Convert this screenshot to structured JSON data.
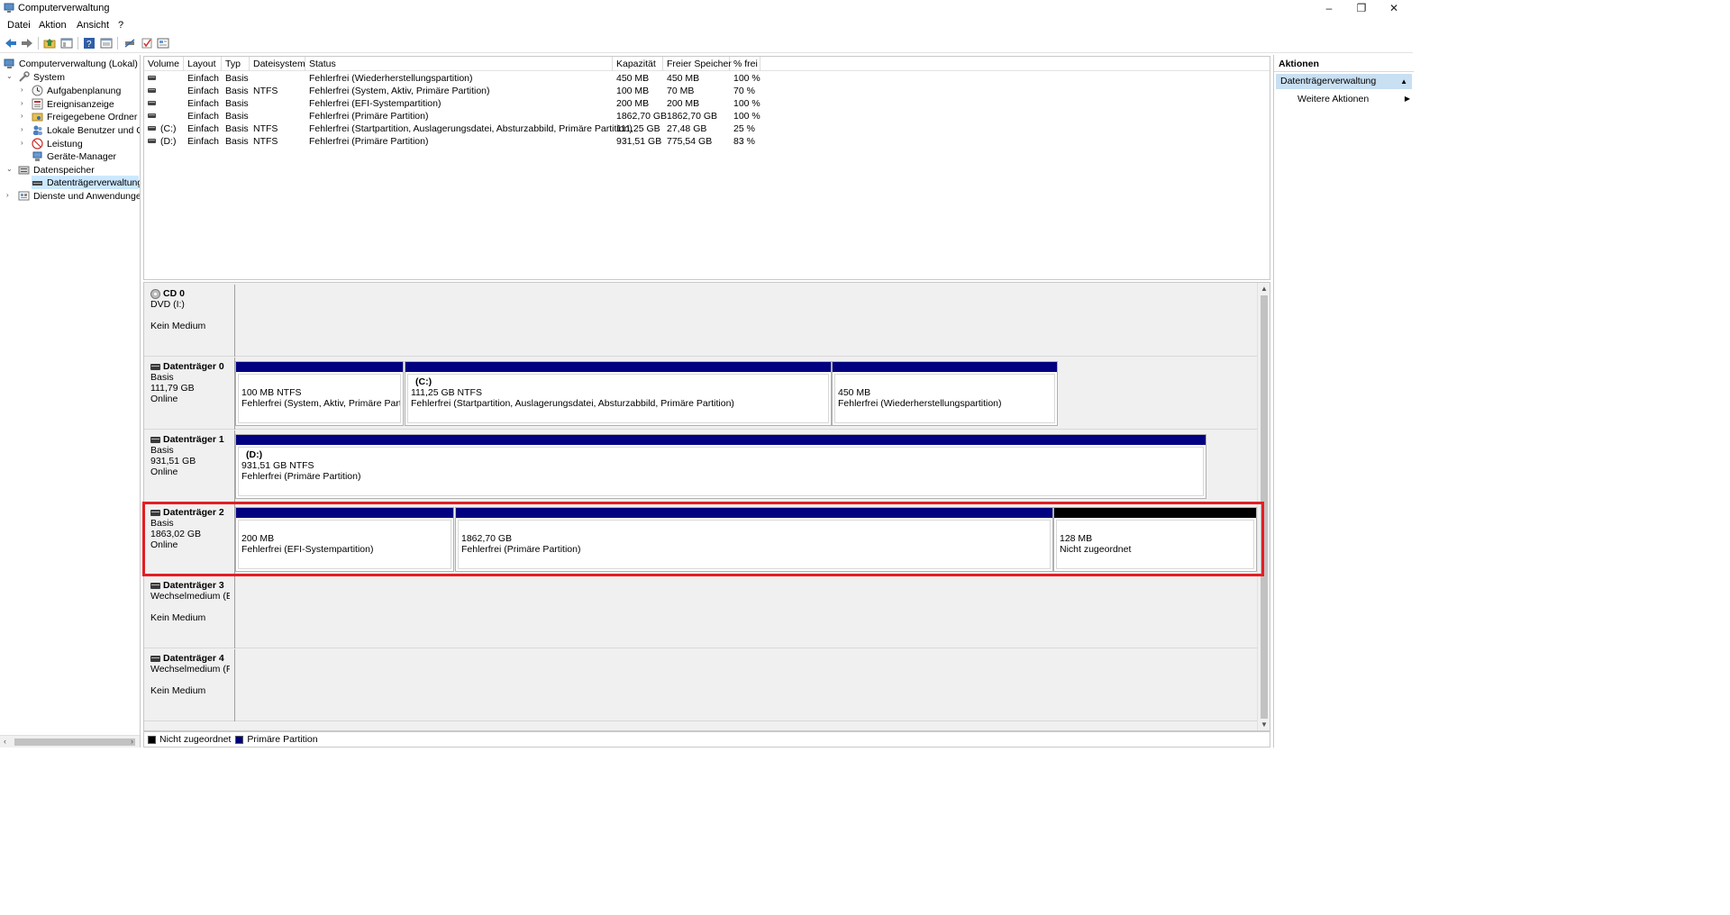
{
  "window": {
    "title": "Computerverwaltung",
    "controls": [
      "–",
      "❐",
      "✕"
    ]
  },
  "menu": [
    "Datei",
    "Aktion",
    "Ansicht",
    "?"
  ],
  "toolbar_icons": [
    "back-arrow-icon",
    "forward-arrow-icon",
    "up-folder-icon",
    "show-hide-tree-icon",
    "help-icon",
    "view-icon",
    "connect-icon",
    "check-icon",
    "properties-icon"
  ],
  "tree": {
    "root": "Computerverwaltung (Lokal)",
    "system": "System",
    "system_items": [
      "Aufgabenplanung",
      "Ereignisanzeige",
      "Freigegebene Ordner",
      "Lokale Benutzer und Gr",
      "Leistung",
      "Geräte-Manager"
    ],
    "storage": "Datenspeicher",
    "storage_items": [
      "Datenträgerverwaltung"
    ],
    "services": "Dienste und Anwendungen"
  },
  "volumes": {
    "headers": [
      "Volume",
      "Layout",
      "Typ",
      "Dateisystem",
      "Status",
      "Kapazität",
      "Freier Speicher",
      "% frei"
    ],
    "rows": [
      [
        "",
        "Einfach",
        "Basis",
        "",
        "Fehlerfrei (Wiederherstellungspartition)",
        "450 MB",
        "450 MB",
        "100 %"
      ],
      [
        "",
        "Einfach",
        "Basis",
        "NTFS",
        "Fehlerfrei (System, Aktiv, Primäre Partition)",
        "100 MB",
        "70 MB",
        "70 %"
      ],
      [
        "",
        "Einfach",
        "Basis",
        "",
        "Fehlerfrei (EFI-Systempartition)",
        "200 MB",
        "200 MB",
        "100 %"
      ],
      [
        "",
        "Einfach",
        "Basis",
        "",
        "Fehlerfrei (Primäre Partition)",
        "1862,70 GB",
        "1862,70 GB",
        "100 %"
      ],
      [
        "(C:)",
        "Einfach",
        "Basis",
        "NTFS",
        "Fehlerfrei (Startpartition, Auslagerungsdatei, Absturzabbild, Primäre Partition)",
        "111,25 GB",
        "27,48 GB",
        "25 %"
      ],
      [
        "(D:)",
        "Einfach",
        "Basis",
        "NTFS",
        "Fehlerfrei (Primäre Partition)",
        "931,51 GB",
        "775,54 GB",
        "83 %"
      ]
    ]
  },
  "disks": [
    {
      "name": "CD 0",
      "lines": [
        "DVD (I:)",
        "",
        "Kein Medium"
      ],
      "partitions": []
    },
    {
      "name": "Datenträger 0",
      "lines": [
        "Basis",
        "111,79 GB",
        "Online"
      ],
      "partitions": [
        {
          "label": "",
          "size": "100 MB NTFS",
          "status": "Fehlerfrei (System, Aktiv, Primäre Partitio",
          "type": "primary"
        },
        {
          "label": "(C:)",
          "size": "111,25 GB NTFS",
          "status": "Fehlerfrei (Startpartition, Auslagerungsdatei, Absturzabbild, Primäre Partition)",
          "type": "primary"
        },
        {
          "label": "",
          "size": "450 MB",
          "status": "Fehlerfrei (Wiederherstellungspartition)",
          "type": "primary"
        }
      ]
    },
    {
      "name": "Datenträger 1",
      "lines": [
        "Basis",
        "931,51 GB",
        "Online"
      ],
      "partitions": [
        {
          "label": "(D:)",
          "size": "931,51 GB NTFS",
          "status": "Fehlerfrei (Primäre Partition)",
          "type": "primary"
        }
      ]
    },
    {
      "name": "Datenträger 2",
      "lines": [
        "Basis",
        "1863,02 GB",
        "Online"
      ],
      "partitions": [
        {
          "label": "",
          "size": "200 MB",
          "status": "Fehlerfrei (EFI-Systempartition)",
          "type": "primary"
        },
        {
          "label": "",
          "size": "1862,70 GB",
          "status": "Fehlerfrei (Primäre Partition)",
          "type": "primary"
        },
        {
          "label": "",
          "size": "128 MB",
          "status": "Nicht zugeordnet",
          "type": "unallocated"
        }
      ]
    },
    {
      "name": "Datenträger 3",
      "lines": [
        "Wechselmedium (E:",
        "",
        "Kein Medium"
      ],
      "partitions": []
    },
    {
      "name": "Datenträger 4",
      "lines": [
        "Wechselmedium (F:",
        "",
        "Kein Medium"
      ],
      "partitions": []
    }
  ],
  "legend": [
    {
      "label": "Nicht zugeordnet",
      "color": "#000000"
    },
    {
      "label": "Primäre Partition",
      "color": "#000080"
    }
  ],
  "actions": {
    "header": "Aktionen",
    "section": "Datenträgerverwaltung",
    "more": "Weitere Aktionen"
  },
  "colors": {
    "primary_partition": "#000080",
    "unallocated": "#000000",
    "highlight": "#e31e24",
    "selection": "#cce8ff"
  }
}
